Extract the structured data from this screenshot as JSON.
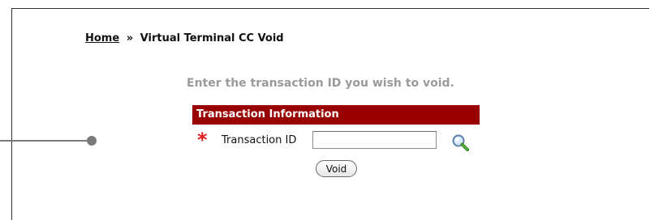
{
  "breadcrumb": {
    "home": "Home",
    "separator": "»",
    "current": "Virtual Terminal CC Void"
  },
  "instruction": "Enter the transaction ID you wish to void.",
  "section": {
    "header": "Transaction Information",
    "field_label": "Transaction ID",
    "required_mark": "*",
    "input_value": "",
    "lookup_icon": "magnifier-search-icon"
  },
  "actions": {
    "void_label": "Void"
  },
  "colors": {
    "header_bg": "#990000",
    "required": "#e11a1a",
    "instruction_text": "#9a9a9a",
    "callout": "#7a7a7a"
  }
}
